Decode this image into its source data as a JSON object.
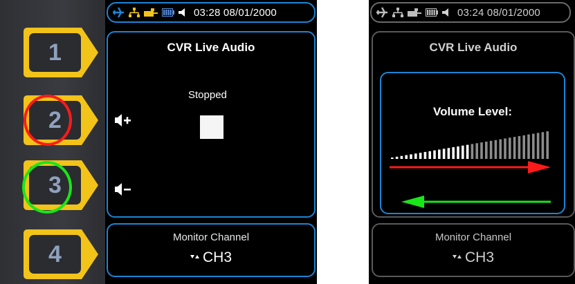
{
  "softkeys": [
    "1",
    "2",
    "3",
    "4"
  ],
  "left_screen": {
    "time": "03:28 08/01/2000",
    "title": "CVR Live Audio",
    "status": "Stopped",
    "monitor_title": "Monitor Channel",
    "monitor_value": "CH3"
  },
  "right_screen": {
    "time": "03:24 08/01/2000",
    "title": "CVR Live Audio",
    "volume_label": "Volume Level:",
    "monitor_title": "Monitor Channel",
    "monitor_value": "CH3",
    "volume_bars_total": 34,
    "volume_bars_active": 17
  },
  "annotations": {
    "highlight_key_2": "red",
    "highlight_key_3": "green",
    "arrow_up_color": "#ff1a1a",
    "arrow_down_color": "#19e619"
  },
  "colors": {
    "accent": "#1a86d8",
    "softkey_yellow": "#f2c319",
    "status_icon_yellow": "#f2c319",
    "airplane_blue": "#1a86d8"
  }
}
